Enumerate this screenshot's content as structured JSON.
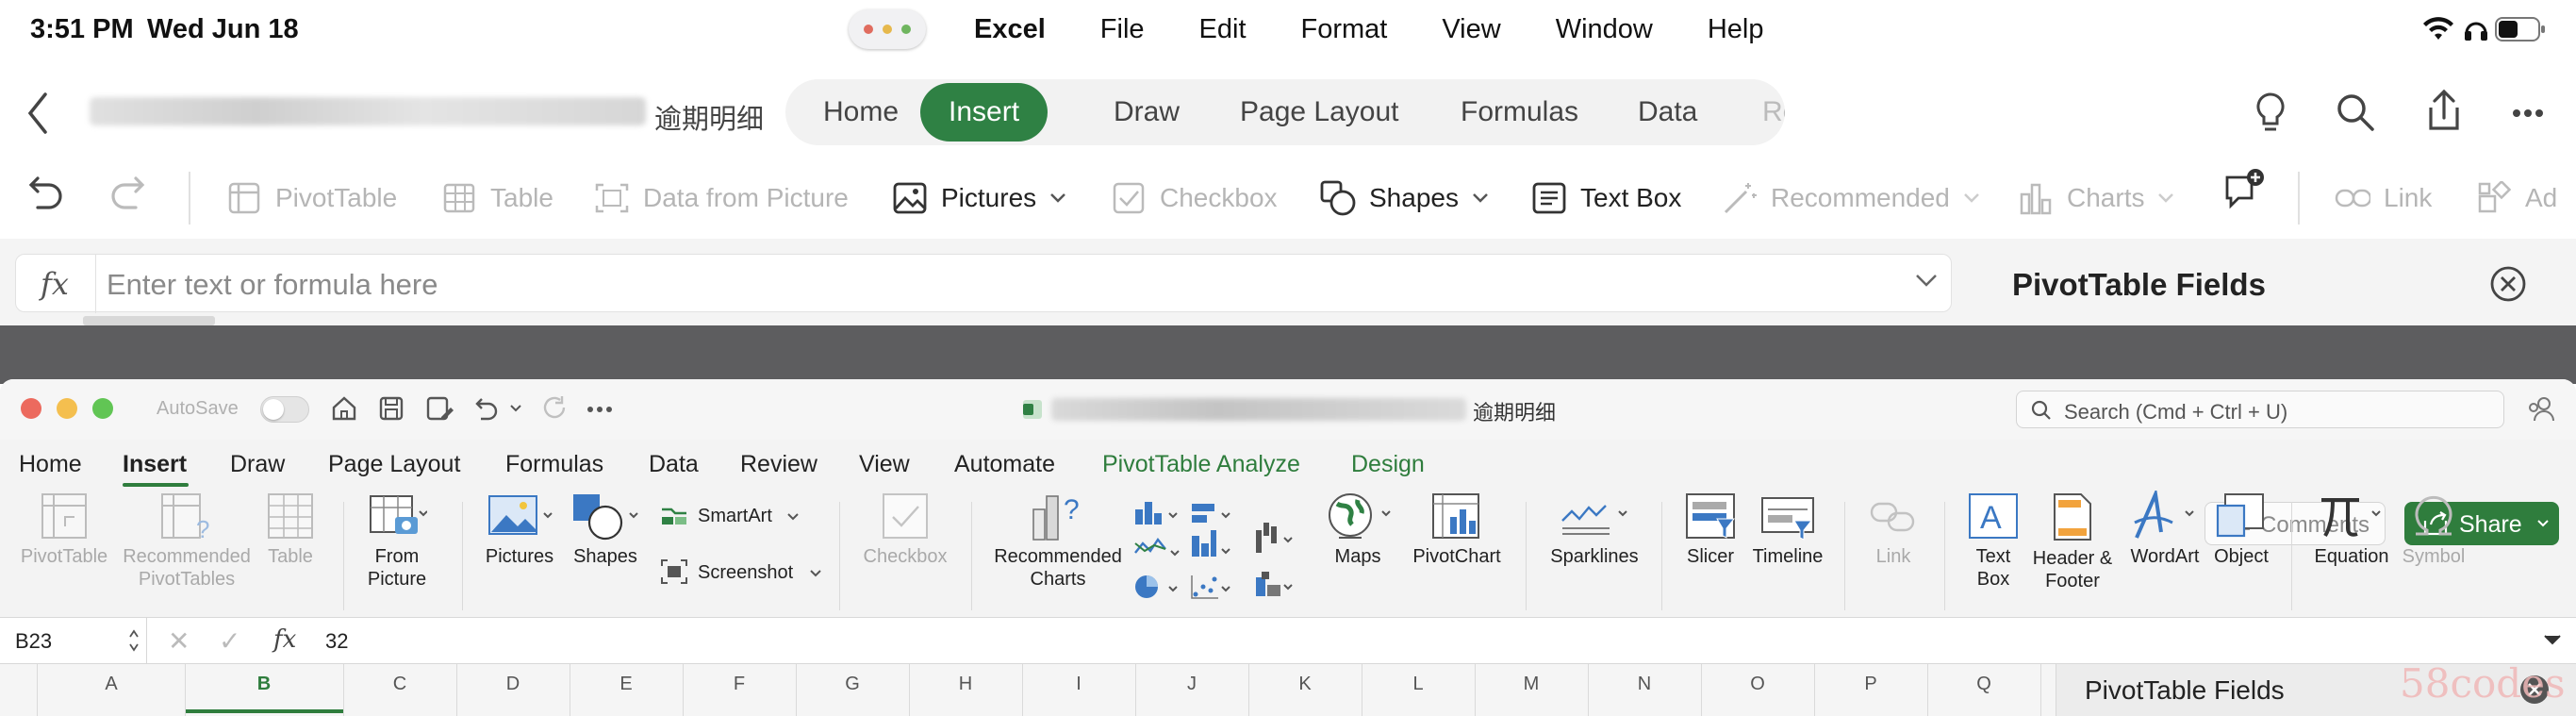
{
  "status_bar": {
    "time": "3:51 PM",
    "date": "Wed Jun 18"
  },
  "menu_bar": {
    "app": "Excel",
    "items": [
      "File",
      "Edit",
      "Format",
      "View",
      "Window",
      "Help"
    ]
  },
  "ipad": {
    "file_name_suffix": "逾期明细",
    "tabs": [
      "Home",
      "Insert",
      "Draw",
      "Page Layout",
      "Formulas",
      "Data",
      "Revi"
    ],
    "active_tab": "Insert",
    "toolbar": {
      "pivottable": "PivotTable",
      "table": "Table",
      "data_from_picture": "Data from Picture",
      "pictures": "Pictures",
      "checkbox": "Checkbox",
      "shapes": "Shapes",
      "text_box": "Text Box",
      "recommended": "Recommended",
      "charts": "Charts",
      "link": "Link",
      "add": "Ad"
    },
    "formula_bar": {
      "fx": "fx",
      "placeholder": "Enter text or formula here"
    },
    "side_panel_title": "PivotTable Fields"
  },
  "mac": {
    "autosave": "AutoSave",
    "title_suffix": "逾期明细",
    "search_placeholder": "Search (Cmd + Ctrl + U)",
    "ribbon_tabs": [
      "Home",
      "Insert",
      "Draw",
      "Page Layout",
      "Formulas",
      "Data",
      "Review",
      "View",
      "Automate",
      "PivotTable Analyze",
      "Design"
    ],
    "active_tab": "Insert",
    "comments": "Comments",
    "share": "Share",
    "ribbon": {
      "pivottable": "PivotTable",
      "recommended_pivottables_1": "Recommended",
      "recommended_pivottables_2": "PivotTables",
      "table": "Table",
      "from_picture_1": "From",
      "from_picture_2": "Picture",
      "pictures": "Pictures",
      "shapes": "Shapes",
      "smartart": "SmartArt",
      "screenshot": "Screenshot",
      "checkbox": "Checkbox",
      "recommended_charts_1": "Recommended",
      "recommended_charts_2": "Charts",
      "maps": "Maps",
      "pivotchart": "PivotChart",
      "sparklines": "Sparklines",
      "slicer": "Slicer",
      "timeline": "Timeline",
      "link": "Link",
      "text_box_1": "Text",
      "text_box_2": "Box",
      "header_footer_1": "Header &",
      "header_footer_2": "Footer",
      "wordart": "WordArt",
      "object": "Object",
      "equation": "Equation",
      "symbol": "Symbol"
    },
    "name_box": "B23",
    "formula_value": "32",
    "columns": [
      "A",
      "B",
      "C",
      "D",
      "E",
      "F",
      "G",
      "H",
      "I",
      "J",
      "K",
      "L",
      "M",
      "N",
      "O",
      "P",
      "Q"
    ],
    "side_panel_title": "PivotTable Fields"
  },
  "watermark": "58codes",
  "colors": {
    "excel_green": "#2f8144",
    "accent_green": "#2f7d3d",
    "dark_band": "#5d5d5f"
  }
}
